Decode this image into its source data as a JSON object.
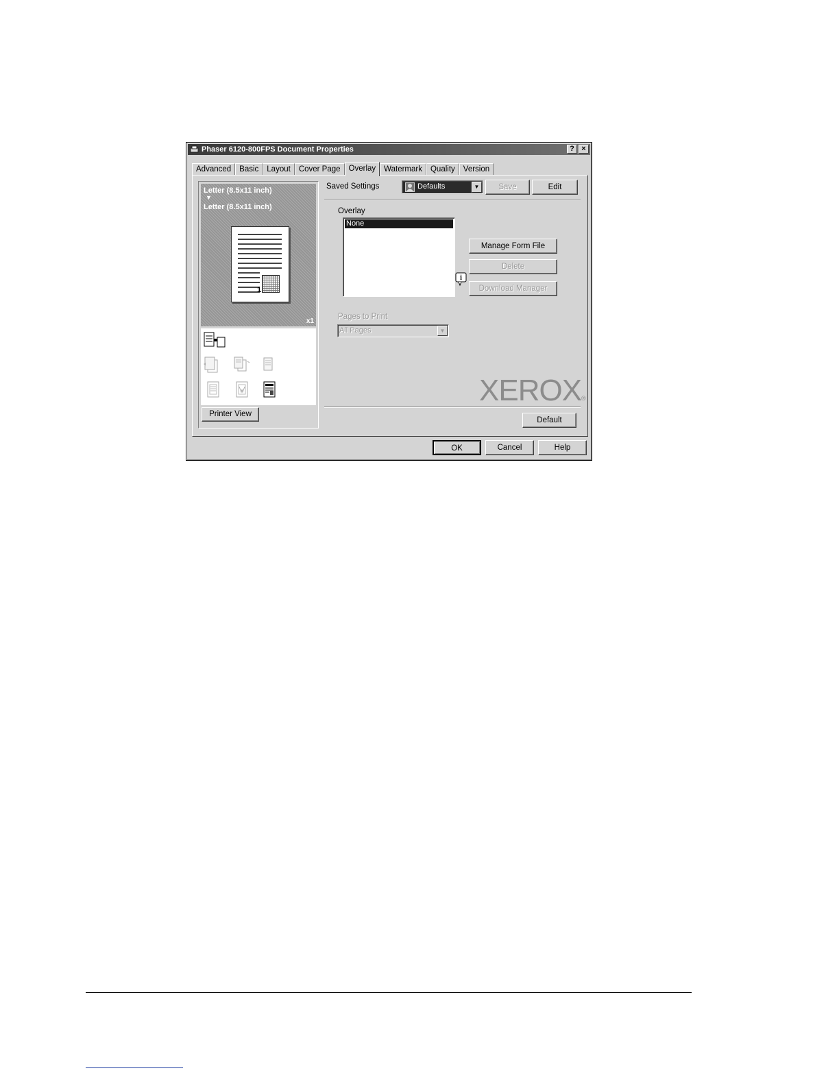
{
  "dialog": {
    "title": "Phaser 6120-800FPS Document Properties",
    "help_btn": "?",
    "close_btn": "×"
  },
  "tabs": [
    "Advanced",
    "Basic",
    "Layout",
    "Cover Page",
    "Overlay",
    "Watermark",
    "Quality",
    "Version"
  ],
  "active_tab": "Overlay",
  "preview": {
    "source_paper": "Letter (8.5x11 inch)",
    "output_paper": "Letter (8.5x11 inch)",
    "page_number": "1",
    "copies": "x1",
    "printer_view_label": "Printer View"
  },
  "saved_settings": {
    "label": "Saved Settings",
    "value": "Defaults",
    "save_label": "Save",
    "edit_label": "Edit"
  },
  "overlay": {
    "label": "Overlay",
    "items": [
      "None"
    ],
    "selected": "None",
    "manage_form_file_label": "Manage Form File",
    "delete_label": "Delete",
    "download_manager_label": "Download Manager"
  },
  "pages_to_print": {
    "label": "Pages to Print",
    "value": "All Pages"
  },
  "brand": {
    "logo_text": "XEROX",
    "reg_mark": "®"
  },
  "default_label": "Default",
  "footer_buttons": {
    "ok": "OK",
    "cancel": "Cancel",
    "help": "Help"
  }
}
